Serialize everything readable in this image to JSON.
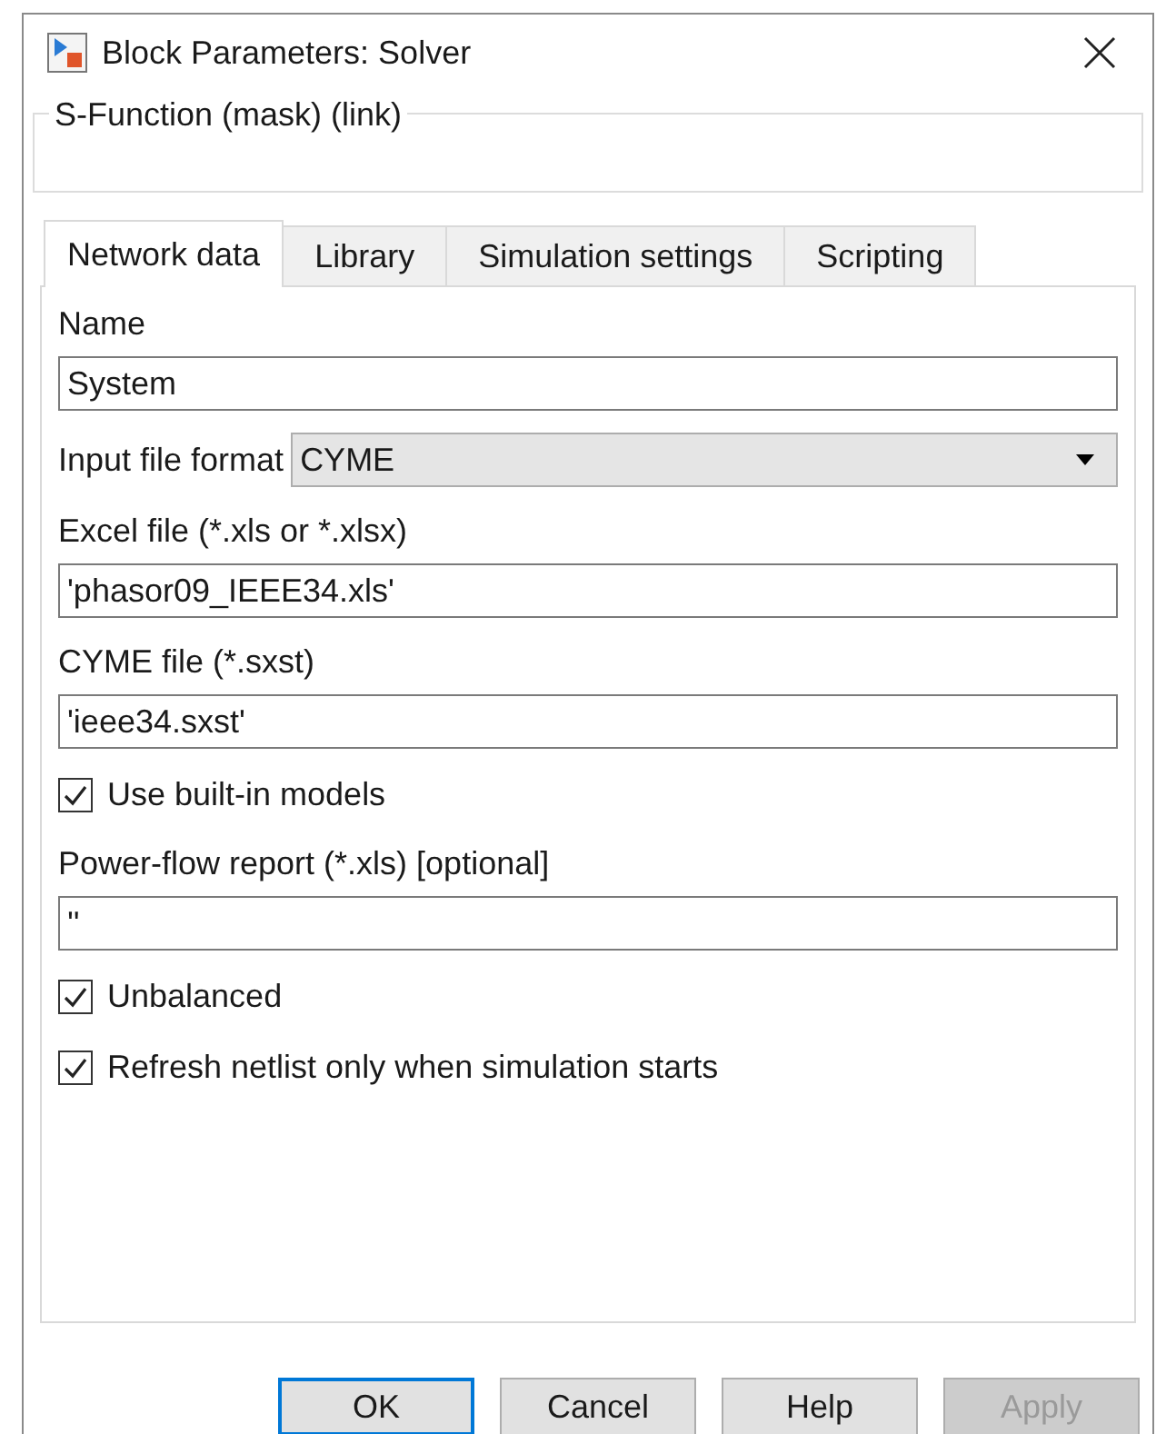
{
  "window": {
    "title": "Block Parameters: Solver"
  },
  "group": {
    "title": "S-Function (mask) (link)"
  },
  "tabs": [
    {
      "label": "Network data",
      "selected": true
    },
    {
      "label": "Library",
      "selected": false
    },
    {
      "label": "Simulation settings",
      "selected": false
    },
    {
      "label": "Scripting",
      "selected": false
    }
  ],
  "parameters": [
    {
      "kind": "text",
      "label": "Name",
      "value": "System"
    },
    {
      "kind": "dropdown",
      "label": "Input file format",
      "value": "CYME"
    },
    {
      "kind": "text",
      "label": "Excel file (*.xls or *.xlsx)",
      "value": "'phasor09_IEEE34.xls'"
    },
    {
      "kind": "text",
      "label": "CYME file (*.sxst)",
      "value": "'ieee34.sxst'"
    },
    {
      "kind": "checkbox",
      "label": "Use built-in models",
      "checked": true
    },
    {
      "kind": "text",
      "label": "Power-flow report (*.xls) [optional]",
      "value": "''"
    },
    {
      "kind": "checkbox",
      "label": "Unbalanced",
      "checked": true
    },
    {
      "kind": "checkbox",
      "label": "Refresh netlist only when simulation starts",
      "checked": true
    }
  ],
  "buttons": [
    {
      "label": "OK",
      "default": true,
      "disabled": false
    },
    {
      "label": "Cancel",
      "default": false,
      "disabled": false
    },
    {
      "label": "Help",
      "default": false,
      "disabled": false
    },
    {
      "label": "Apply",
      "default": false,
      "disabled": true
    }
  ]
}
